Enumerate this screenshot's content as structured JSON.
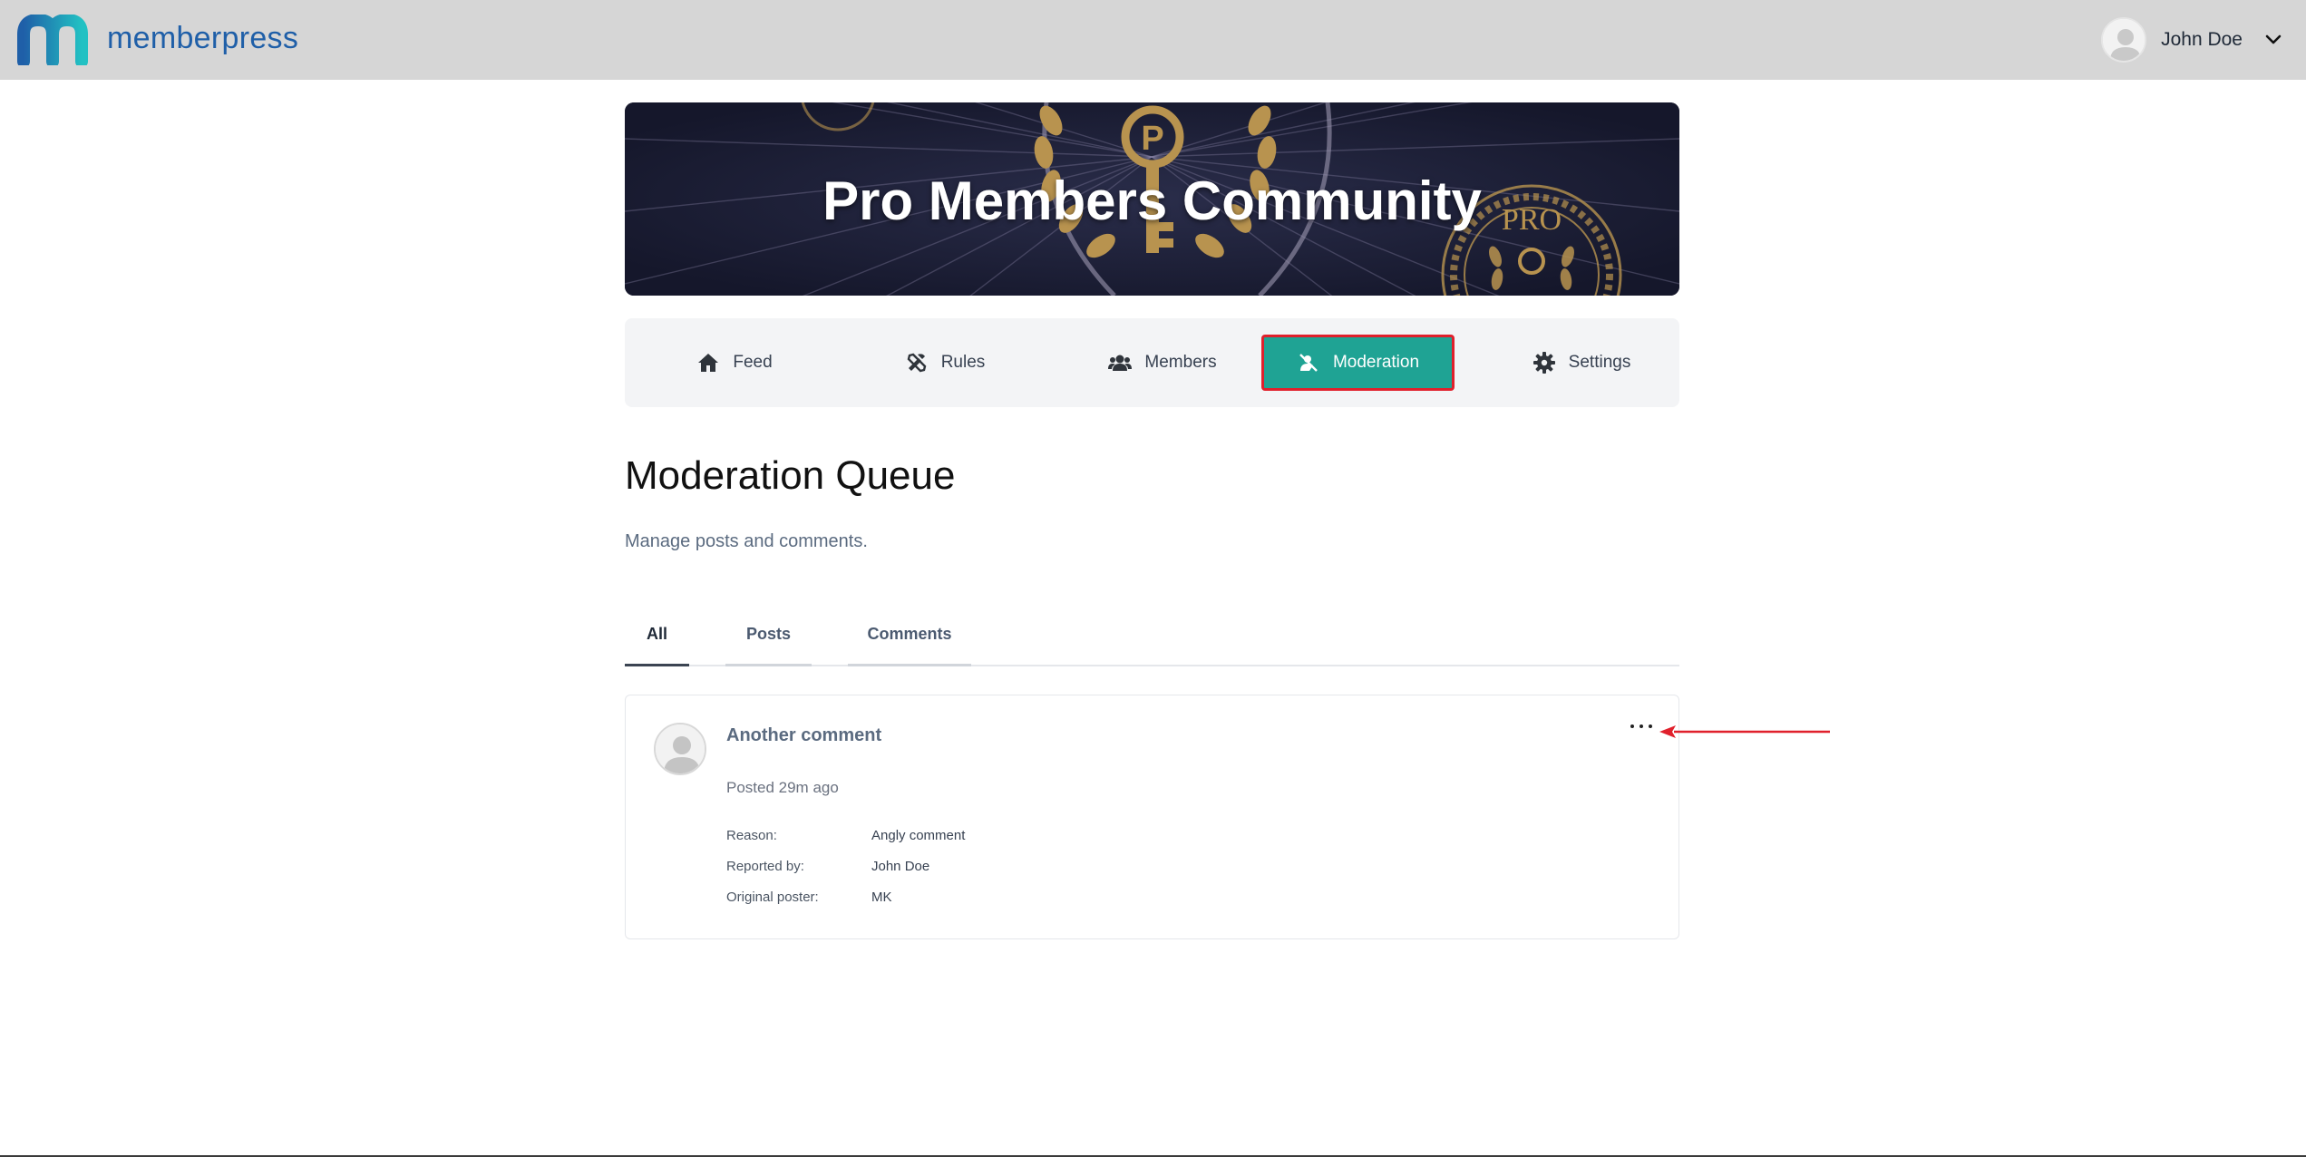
{
  "brand": {
    "name": "memberpress",
    "color": "#1f5fa8",
    "accent": "#22c1c3"
  },
  "user": {
    "name": "John Doe",
    "icon": "chevron-down-icon"
  },
  "banner": {
    "title": "Pro Members Community",
    "background": "#191b33",
    "gold": "#b8934f",
    "badge_text": "PRO"
  },
  "nav": {
    "items": [
      {
        "label": "Feed",
        "icon": "home-icon"
      },
      {
        "label": "Rules",
        "icon": "tools-icon"
      },
      {
        "label": "Members",
        "icon": "users-icon"
      },
      {
        "label": "Moderation",
        "icon": "moderation-icon",
        "active": true
      },
      {
        "label": "Settings",
        "icon": "gear-icon"
      }
    ],
    "active_color": "#1fa394",
    "highlight_border": "#e0202c"
  },
  "page": {
    "title": "Moderation Queue",
    "subtitle": "Manage posts and comments."
  },
  "tabs": [
    {
      "label": "All",
      "active": true
    },
    {
      "label": "Posts"
    },
    {
      "label": "Comments"
    }
  ],
  "queue": [
    {
      "title": "Another comment",
      "posted": "Posted 29m ago",
      "details": [
        {
          "label": "Reason:",
          "value": "Angly comment"
        },
        {
          "label": "Reported by:",
          "value": "John Doe"
        },
        {
          "label": "Original poster:",
          "value": "MK"
        }
      ],
      "more_icon": "ellipsis-icon"
    }
  ],
  "annotation": {
    "color": "#e0202c"
  }
}
